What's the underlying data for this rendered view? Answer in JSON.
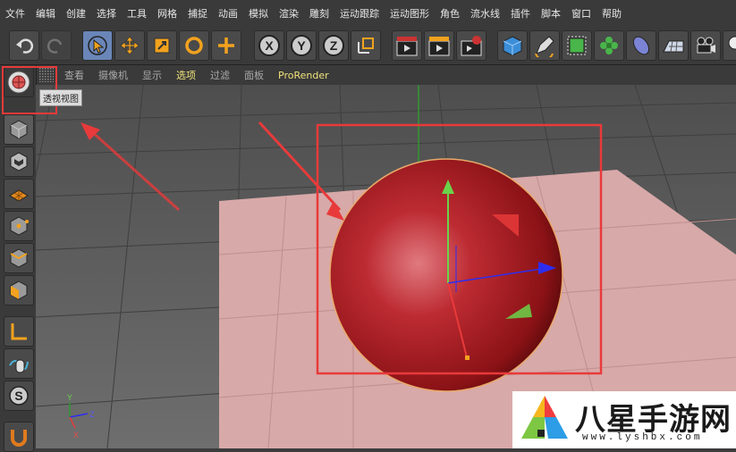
{
  "menu": [
    "文件",
    "编辑",
    "创建",
    "选择",
    "工具",
    "网格",
    "捕捉",
    "动画",
    "模拟",
    "渲染",
    "雕刻",
    "运动跟踪",
    "运动图形",
    "角色",
    "流水线",
    "插件",
    "脚本",
    "窗口",
    "帮助"
  ],
  "view_menu": [
    "查看",
    "摄像机",
    "显示",
    "选项",
    "过滤",
    "面板",
    "ProRender"
  ],
  "tooltip": "透视视图",
  "axes": {
    "x": "X",
    "y": "Y",
    "z": "Z"
  },
  "toolbar_letters": {
    "x": "X",
    "y": "Y",
    "z": "Z"
  },
  "watermark": {
    "brand": "八星手游网",
    "url": "www.lyshbx.com"
  },
  "colors": {
    "accent": "#6a86b8",
    "sphere": "#a61d22",
    "highlight": "#e24a4a",
    "floor": "#d9aaaa",
    "active_menu": "#f0e27a"
  }
}
